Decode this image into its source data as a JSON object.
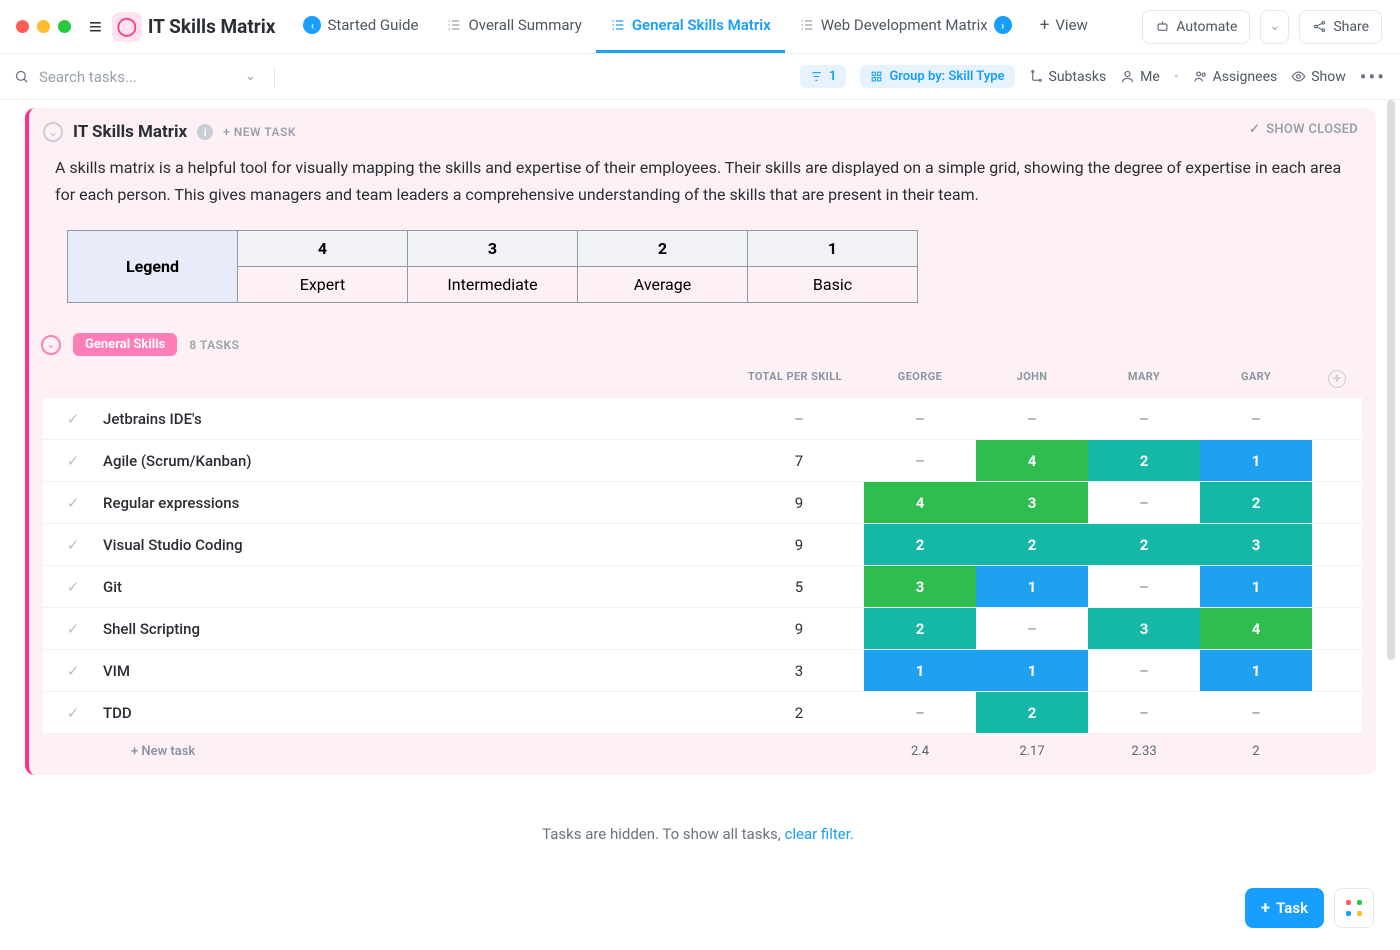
{
  "doc_title": "IT Skills Matrix",
  "tabs": [
    {
      "label": "Started Guide",
      "active": false,
      "badge": "‹",
      "badgeclass": "mini"
    },
    {
      "label": "Overall Summary",
      "active": false,
      "badge": "",
      "badgeclass": "mini grey"
    },
    {
      "label": "General Skills Matrix",
      "active": true,
      "badge": "",
      "badgeclass": ""
    },
    {
      "label": "Web Development Matrix",
      "active": false,
      "badge": "›",
      "badgeclass": "mini"
    }
  ],
  "topbar": {
    "view": "View",
    "automate": "Automate",
    "share": "Share"
  },
  "toolbar": {
    "search_placeholder": "Search tasks...",
    "filter_count": "1",
    "group_by": "Group by: Skill Type",
    "subtasks": "Subtasks",
    "me": "Me",
    "assignees": "Assignees",
    "show": "Show"
  },
  "card": {
    "title": "IT Skills Matrix",
    "new_task": "+ NEW TASK",
    "show_closed": "SHOW CLOSED",
    "description": "A skills matrix is a helpful tool for visually mapping the skills and expertise of their employees. Their skills are displayed on a simple grid, showing the degree of expertise in each area for each person. This gives managers and team leaders a comprehensive understanding of the skills that are present in their team."
  },
  "legend": {
    "header": "Legend",
    "levels": [
      {
        "num": "4",
        "label": "Expert"
      },
      {
        "num": "3",
        "label": "Intermediate"
      },
      {
        "num": "2",
        "label": "Average"
      },
      {
        "num": "1",
        "label": "Basic"
      }
    ]
  },
  "group": {
    "name": "General Skills",
    "count": "8 TASKS"
  },
  "columns": {
    "total": "TOTAL PER SKILL",
    "people": [
      "GEORGE",
      "JOHN",
      "MARY",
      "GARY"
    ]
  },
  "rows": [
    {
      "name": "Jetbrains IDE's",
      "total": "–",
      "vals": [
        null,
        null,
        null,
        null
      ]
    },
    {
      "name": "Agile (Scrum/Kanban)",
      "total": "7",
      "vals": [
        null,
        4,
        2,
        1
      ]
    },
    {
      "name": "Regular expressions",
      "total": "9",
      "vals": [
        4,
        3,
        null,
        2
      ]
    },
    {
      "name": "Visual Studio Coding",
      "total": "9",
      "vals": [
        2,
        2,
        2,
        3
      ]
    },
    {
      "name": "Git",
      "total": "5",
      "vals": [
        3,
        1,
        null,
        1
      ]
    },
    {
      "name": "Shell Scripting",
      "total": "9",
      "vals": [
        2,
        null,
        3,
        4
      ]
    },
    {
      "name": "VIM",
      "total": "3",
      "vals": [
        1,
        1,
        null,
        1
      ]
    },
    {
      "name": "TDD",
      "total": "2",
      "vals": [
        null,
        2,
        null,
        null
      ]
    }
  ],
  "averages": [
    "2.4",
    "2.17",
    "2.33",
    "2"
  ],
  "new_task_row": "+ New task",
  "hidden_notice": {
    "text": "Tasks are hidden. To show all tasks, ",
    "link": "clear filter",
    "suffix": "."
  },
  "float": {
    "task": "Task"
  },
  "colors": {
    "1": "c-blue",
    "2": "c-teal",
    "3": "c-teal",
    "4": "c-green"
  },
  "color_override": {
    "2_1": "c-green",
    "4_0": "c-green"
  }
}
